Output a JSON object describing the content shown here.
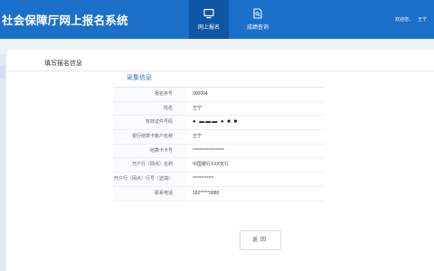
{
  "header": {
    "title": "社会保障厅网上报名系统",
    "user_greeting": "欢迎您，",
    "user_name": "王宁",
    "tabs": [
      {
        "label": "网上报名",
        "icon": "monitor-icon",
        "active": true
      },
      {
        "label": "成绩查询",
        "icon": "document-search-icon",
        "active": false
      }
    ]
  },
  "main": {
    "section_title": "填写报名信息",
    "subsection_title": "采集信息",
    "fields": [
      {
        "label": "报名序号",
        "value": "000004"
      },
      {
        "label": "姓名",
        "value": "王宁"
      },
      {
        "label": "有效证件号码",
        "value": "●  ▬▬▬ ●  ■  ■"
      },
      {
        "label": "银行结算卡账户名称",
        "value": "王宁"
      },
      {
        "label": "结算卡卡号",
        "value": "******************"
      },
      {
        "label": "开户行（网点）名称",
        "value": "中国银行XXX支行"
      },
      {
        "label": "开户行（网点）行号（选填）",
        "value": "************"
      },
      {
        "label": "联系电话",
        "value": "182*****5888"
      }
    ],
    "back_button": "返回"
  },
  "colors": {
    "header_bg": "#1a6fc9",
    "active_tab_bg": "#0f56a6",
    "accent_text": "#3b6fb5"
  }
}
